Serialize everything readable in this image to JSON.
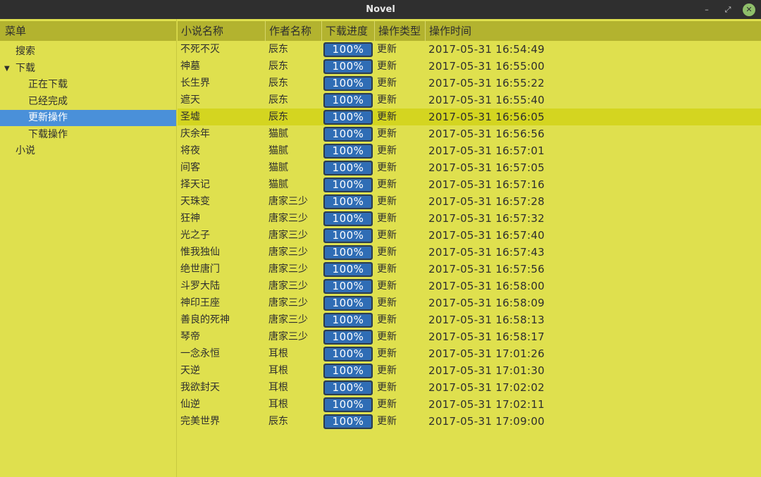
{
  "window": {
    "title": "Novel",
    "buttons": {
      "minimize": "–",
      "maximize": "⤢",
      "close": "✕"
    }
  },
  "sidebar": {
    "header": "菜单",
    "items": [
      {
        "label": "搜索",
        "level": 1
      },
      {
        "label": "下载",
        "level": 0,
        "expanded": true
      },
      {
        "label": "正在下载",
        "level": 2
      },
      {
        "label": "已经完成",
        "level": 2
      },
      {
        "label": "更新操作",
        "level": 2,
        "selected": true
      },
      {
        "label": "下载操作",
        "level": 2
      },
      {
        "label": "小说",
        "level": 1
      }
    ]
  },
  "table": {
    "columns": [
      "小说名称",
      "作者名称",
      "下载进度",
      "操作类型",
      "操作时间"
    ],
    "selected_row": 4,
    "rows": [
      {
        "name": "不死不灭",
        "author": "辰东",
        "progress": 100,
        "progress_label": "100%",
        "type": "更新",
        "time": "2017-05-31 16:54:49"
      },
      {
        "name": "神墓",
        "author": "辰东",
        "progress": 100,
        "progress_label": "100%",
        "type": "更新",
        "time": "2017-05-31 16:55:00"
      },
      {
        "name": "长生界",
        "author": "辰东",
        "progress": 100,
        "progress_label": "100%",
        "type": "更新",
        "time": "2017-05-31 16:55:22"
      },
      {
        "name": "遮天",
        "author": "辰东",
        "progress": 100,
        "progress_label": "100%",
        "type": "更新",
        "time": "2017-05-31 16:55:40"
      },
      {
        "name": "圣墟",
        "author": "辰东",
        "progress": 100,
        "progress_label": "100%",
        "type": "更新",
        "time": "2017-05-31 16:56:05"
      },
      {
        "name": "庆余年",
        "author": "猫腻",
        "progress": 100,
        "progress_label": "100%",
        "type": "更新",
        "time": "2017-05-31 16:56:56"
      },
      {
        "name": "将夜",
        "author": "猫腻",
        "progress": 100,
        "progress_label": "100%",
        "type": "更新",
        "time": "2017-05-31 16:57:01"
      },
      {
        "name": "间客",
        "author": "猫腻",
        "progress": 100,
        "progress_label": "100%",
        "type": "更新",
        "time": "2017-05-31 16:57:05"
      },
      {
        "name": "择天记",
        "author": "猫腻",
        "progress": 100,
        "progress_label": "100%",
        "type": "更新",
        "time": "2017-05-31 16:57:16"
      },
      {
        "name": "天珠变",
        "author": "唐家三少",
        "progress": 100,
        "progress_label": "100%",
        "type": "更新",
        "time": "2017-05-31 16:57:28"
      },
      {
        "name": "狂神",
        "author": "唐家三少",
        "progress": 100,
        "progress_label": "100%",
        "type": "更新",
        "time": "2017-05-31 16:57:32"
      },
      {
        "name": "光之子",
        "author": "唐家三少",
        "progress": 100,
        "progress_label": "100%",
        "type": "更新",
        "time": "2017-05-31 16:57:40"
      },
      {
        "name": "惟我独仙",
        "author": "唐家三少",
        "progress": 100,
        "progress_label": "100%",
        "type": "更新",
        "time": "2017-05-31 16:57:43"
      },
      {
        "name": "绝世唐门",
        "author": "唐家三少",
        "progress": 100,
        "progress_label": "100%",
        "type": "更新",
        "time": "2017-05-31 16:57:56"
      },
      {
        "name": "斗罗大陆",
        "author": "唐家三少",
        "progress": 100,
        "progress_label": "100%",
        "type": "更新",
        "time": "2017-05-31 16:58:00"
      },
      {
        "name": "神印王座",
        "author": "唐家三少",
        "progress": 100,
        "progress_label": "100%",
        "type": "更新",
        "time": "2017-05-31 16:58:09"
      },
      {
        "name": "善良的死神",
        "author": "唐家三少",
        "progress": 100,
        "progress_label": "100%",
        "type": "更新",
        "time": "2017-05-31 16:58:13"
      },
      {
        "name": "琴帝",
        "author": "唐家三少",
        "progress": 100,
        "progress_label": "100%",
        "type": "更新",
        "time": "2017-05-31 16:58:17"
      },
      {
        "name": "一念永恒",
        "author": "耳根",
        "progress": 100,
        "progress_label": "100%",
        "type": "更新",
        "time": "2017-05-31 17:01:26"
      },
      {
        "name": "天逆",
        "author": "耳根",
        "progress": 100,
        "progress_label": "100%",
        "type": "更新",
        "time": "2017-05-31 17:01:30"
      },
      {
        "name": "我欲封天",
        "author": "耳根",
        "progress": 100,
        "progress_label": "100%",
        "type": "更新",
        "time": "2017-05-31 17:02:02"
      },
      {
        "name": "仙逆",
        "author": "耳根",
        "progress": 100,
        "progress_label": "100%",
        "type": "更新",
        "time": "2017-05-31 17:02:11"
      },
      {
        "name": "完美世界",
        "author": "辰东",
        "progress": 100,
        "progress_label": "100%",
        "type": "更新",
        "time": "2017-05-31 17:09:00"
      }
    ]
  },
  "colors": {
    "background": "#dfe04e",
    "header": "#b3b32f",
    "selection_sidebar": "#4a90d9",
    "selection_row": "#d4d520",
    "progress_fill": "#2f6db5",
    "titlebar": "#2f2f2f"
  },
  "icons": {
    "expand": "triangle-down-icon",
    "window_close": "close-icon",
    "window_max": "maximize-icon",
    "window_min": "minimize-icon"
  }
}
